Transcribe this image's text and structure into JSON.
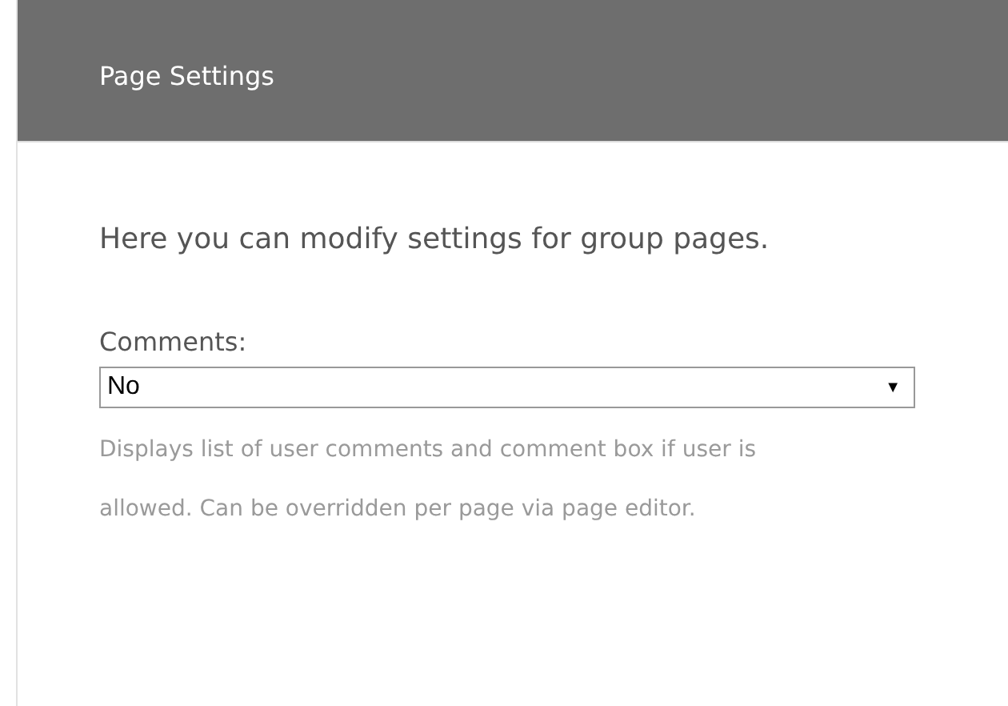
{
  "header": {
    "title": "Page Settings"
  },
  "intro": "Here you can modify settings for group pages.",
  "fields": [
    {
      "kind": "select",
      "label": "Comments:",
      "value": "No",
      "arrow": "▼",
      "help": "Displays list of user comments and comment box if user is allowed. Can be overridden per page via page editor."
    }
  ]
}
